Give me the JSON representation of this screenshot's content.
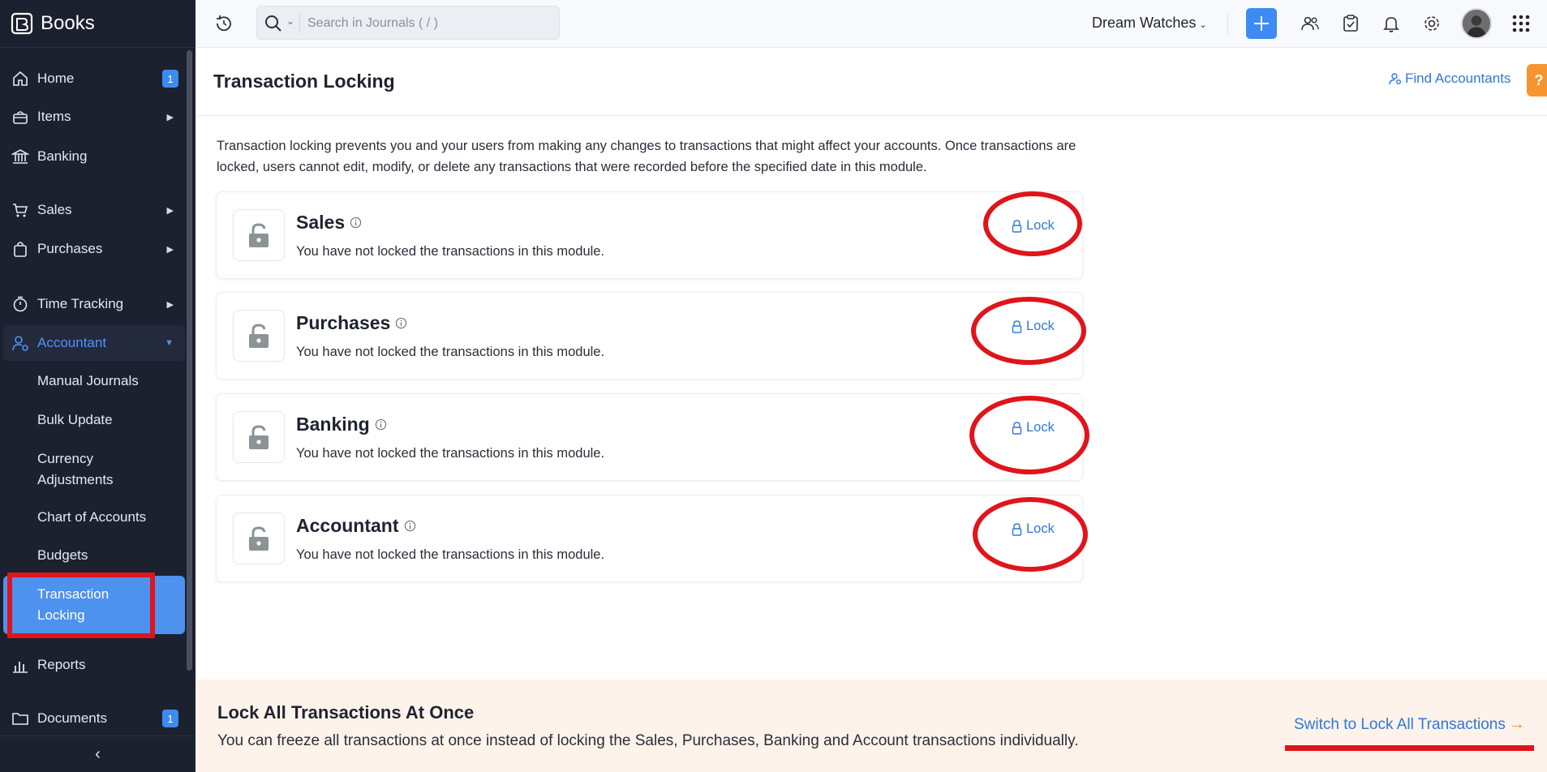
{
  "app": {
    "name": "Books"
  },
  "sidebar": {
    "items": [
      {
        "label": "Home",
        "badge": "1",
        "icon": "home-icon"
      },
      {
        "label": "Items",
        "icon": "basket-icon",
        "arrow": "▶"
      },
      {
        "label": "Banking",
        "icon": "bank-icon"
      },
      {
        "label": "Sales",
        "icon": "cart-icon",
        "arrow": "▶"
      },
      {
        "label": "Purchases",
        "icon": "bag-icon",
        "arrow": "▶"
      },
      {
        "label": "Time Tracking",
        "icon": "stopwatch-icon",
        "arrow": "▶"
      },
      {
        "label": "Accountant",
        "icon": "accountant-icon",
        "arrow": "▼"
      },
      {
        "label": "Reports",
        "icon": "chart-icon"
      },
      {
        "label": "Documents",
        "badge": "1",
        "icon": "folder-icon"
      }
    ],
    "submenu": [
      {
        "label": "Manual Journals"
      },
      {
        "label": "Bulk Update"
      },
      {
        "label": "Currency Adjustments"
      },
      {
        "label": "Chart of Accounts"
      },
      {
        "label": "Budgets"
      },
      {
        "label": "Transaction Locking",
        "active": true
      }
    ],
    "collapse_glyph": "‹"
  },
  "topbar": {
    "search_placeholder": "Search in Journals ( / )",
    "organization": "Dream Watches",
    "org_caret": "⌄"
  },
  "page": {
    "title": "Transaction Locking",
    "find_accountants": "Find Accountants",
    "help_glyph": "?",
    "intro": "Transaction locking prevents you and your users from making any changes to transactions that might affect your accounts. Once transactions are locked, users cannot edit, modify, or delete any transactions that were recorded before the specified date in this module."
  },
  "modules": [
    {
      "name": "Sales",
      "status": "You have not locked the transactions in this module.",
      "action": "Lock"
    },
    {
      "name": "Purchases",
      "status": "You have not locked the transactions in this module.",
      "action": "Lock"
    },
    {
      "name": "Banking",
      "status": "You have not locked the transactions in this module.",
      "action": "Lock"
    },
    {
      "name": "Accountant",
      "status": "You have not locked the transactions in this module.",
      "action": "Lock"
    }
  ],
  "banner": {
    "title": "Lock All Transactions At Once",
    "description": "You can freeze all transactions at once instead of locking the Sales, Purchases, Banking and Account transactions individually.",
    "link": "Switch to Lock All Transactions",
    "link_arrow": "→"
  },
  "colors": {
    "sidebar_bg": "#1c2130",
    "accent": "#3d8bf2",
    "link": "#2f78d8",
    "annotation_red": "#e0141b",
    "help_orange": "#f6952e",
    "banner_bg": "#fdf3ea"
  }
}
